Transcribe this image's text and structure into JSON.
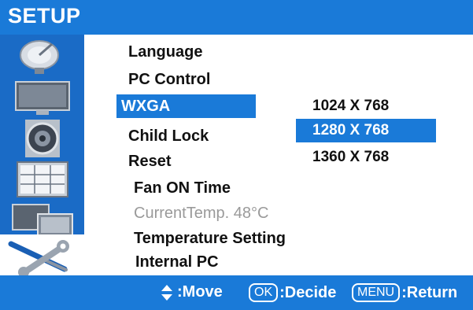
{
  "title": "SETUP",
  "sidebar": {
    "icons": [
      "satellite-dish-icon",
      "monitor-icon",
      "speaker-icon",
      "calendar-clock-icon",
      "dual-screen-icon",
      "wrench-screwdriver-icon"
    ],
    "active": "wrench-screwdriver-icon"
  },
  "menu": {
    "items": [
      "Language",
      "PC Control",
      "WXGA",
      "Child Lock",
      "Reset",
      "Fan ON Time",
      "CurrentTemp. 48°C",
      "Temperature Setting",
      "Internal PC"
    ],
    "selected": "WXGA",
    "disabled": "CurrentTemp. 48°C"
  },
  "submenu": {
    "options": [
      "1024 X 768",
      "1280 X 768",
      "1360 X 768"
    ],
    "selected": "1280 X 768"
  },
  "footer": {
    "move_label": ":Move",
    "ok_key": "OK",
    "decide_label": ":Decide",
    "menu_key": "MENU",
    "return_label": ":Return"
  },
  "colors": {
    "accent": "#1a7ad8",
    "sidebar": "#1a6bc6",
    "text": "#111111",
    "disabled_text": "#9a9a9a"
  }
}
